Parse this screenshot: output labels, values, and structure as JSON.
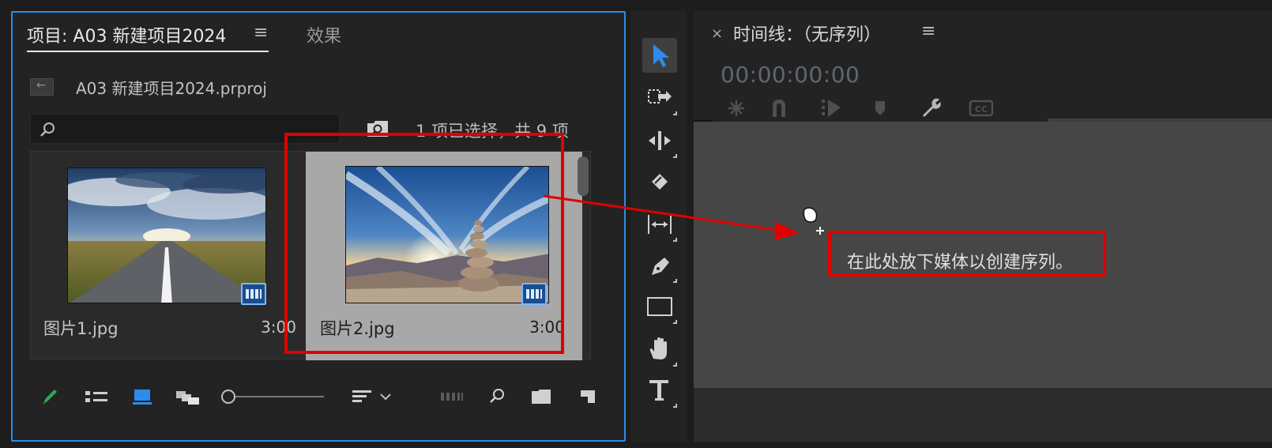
{
  "project_panel": {
    "tab_project": "项目: A03 新建项目2024",
    "tab_menu": "≡",
    "tab_effects": "效果",
    "file_name": "A03 新建项目2024.prproj",
    "search_placeholder": "",
    "selection_status": "1 项已选择，共 9 项",
    "clips": [
      {
        "name": "图片1.jpg",
        "duration": "3:00",
        "selected": false,
        "icon": "image-road-thumbnail"
      },
      {
        "name": "图片2.jpg",
        "duration": "3:00",
        "selected": true,
        "icon": "image-stones-sunset-thumbnail"
      }
    ]
  },
  "tools_panel": {
    "tools": [
      "selection-tool",
      "track-select-forward-tool",
      "ripple-edit-tool",
      "razor-tool",
      "slip-tool",
      "pen-tool",
      "rectangle-tool",
      "hand-tool",
      "type-tool"
    ],
    "selected": "selection-tool"
  },
  "timeline_panel": {
    "close_label": "×",
    "title": "时间线：（无序列）",
    "menu": "≡",
    "timecode": "00:00:00:00",
    "drop_hint": "在此处放下媒体以创建序列。"
  },
  "colors": {
    "accent_blue": "#2d8ceb",
    "annotation_red": "#e00000",
    "selected_clip_bg": "#a8a8a8"
  }
}
